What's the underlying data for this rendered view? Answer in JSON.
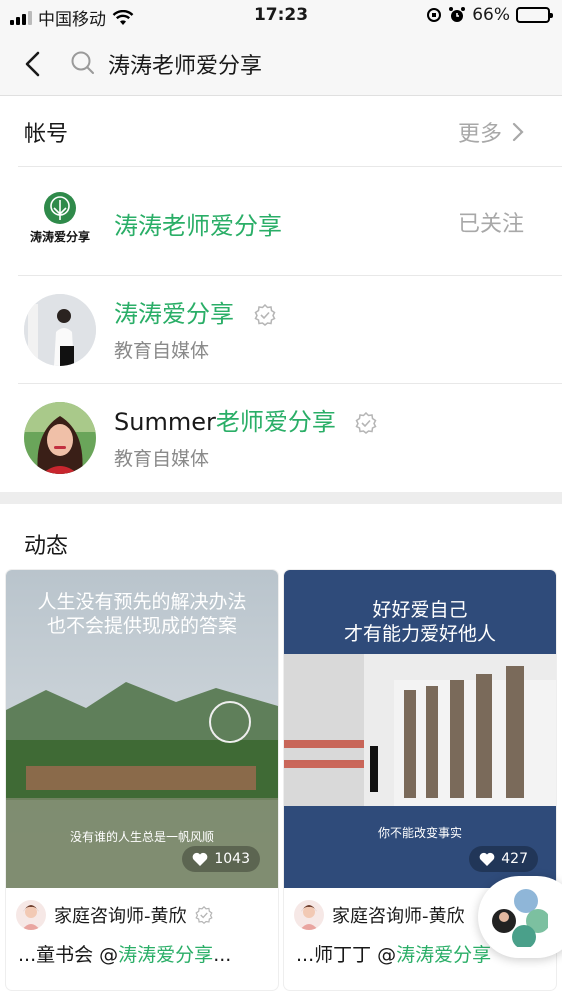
{
  "status_bar": {
    "carrier": "中国移动",
    "time": "17:23",
    "battery": "66%",
    "battery_level": 0.66
  },
  "search": {
    "query": "涛涛老师爱分享"
  },
  "accounts_section": {
    "title": "帐号",
    "more_label": "更多",
    "rows": [
      {
        "name": "涛涛老师爱分享",
        "logo_text": "涛涛爱分享",
        "action": "已关注"
      },
      {
        "name": "涛涛爱分享",
        "subtitle": "教育自媒体",
        "verified": true
      },
      {
        "name_prefix": "Summer",
        "name_highlight": "老师爱分享",
        "subtitle": "教育自媒体",
        "verified": true
      }
    ]
  },
  "feed_section": {
    "title": "动态",
    "cards": [
      {
        "caption_line1": "人生没有预先的解决办法",
        "caption_line2": "也不会提供现成的答案",
        "inner_caption": "没有谁的人生总是一帆风顺",
        "likes": "1043",
        "author": "家庭咨询师-黄欣",
        "excerpt_prefix": "...童书会 @",
        "excerpt_highlight": "涛涛爱分享",
        "excerpt_suffix": "..."
      },
      {
        "caption_line1": "好好爱自己",
        "caption_line2": "才有能力爱好他人",
        "inner_caption": "你不能改变事实",
        "likes": "427",
        "author": "家庭咨询师-黄欣",
        "excerpt_prefix": "...师丁丁 @",
        "excerpt_highlight": "涛涛爱分享",
        "excerpt_suffix": ""
      }
    ]
  },
  "colors": {
    "accent_green": "#2aae67",
    "secondary_text": "#a8a8a8",
    "background": "#ededed"
  }
}
